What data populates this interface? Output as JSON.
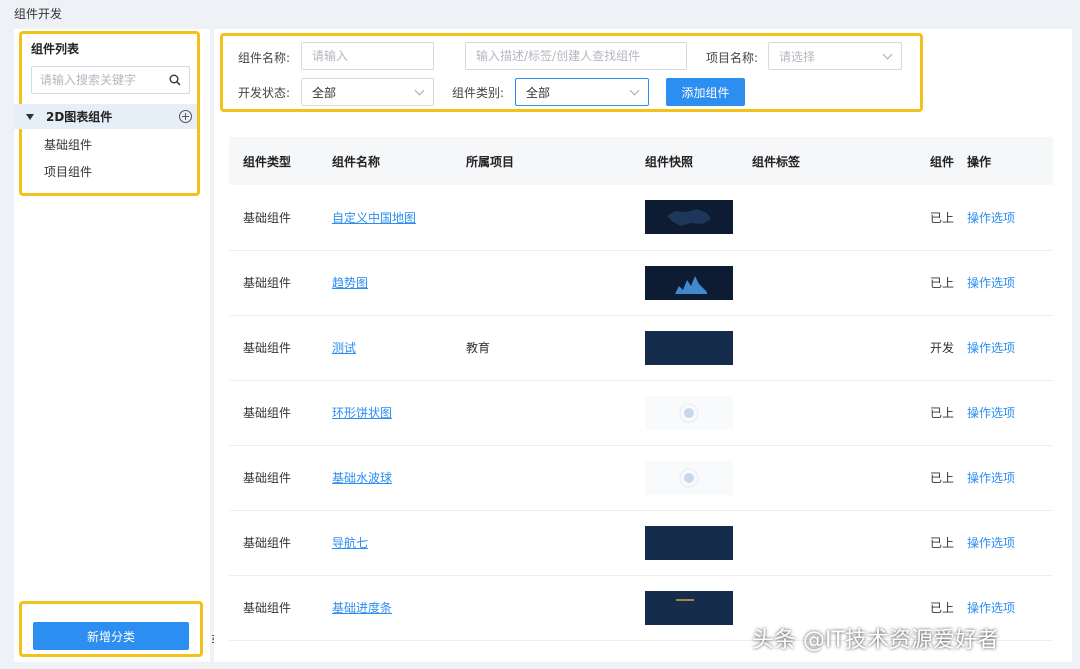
{
  "page": {
    "title": "组件开发"
  },
  "sidebar": {
    "title": "组件列表",
    "search_placeholder": "请输入搜索关键字",
    "group": {
      "label": "2D图表组件"
    },
    "items": [
      {
        "label": "基础组件"
      },
      {
        "label": "项目组件"
      }
    ],
    "add_category_label": "新增分类"
  },
  "filters": {
    "name_label": "组件名称:",
    "name_placeholder": "请输入",
    "desc_placeholder": "输入描述/标签/创建人查找组件",
    "project_label": "项目名称:",
    "project_placeholder": "请选择",
    "status_label": "开发状态:",
    "status_value": "全部",
    "type_label": "组件类别:",
    "type_value": "全部",
    "add_button": "添加组件"
  },
  "table": {
    "headers": {
      "type": "组件类型",
      "name": "组件名称",
      "project": "所属项目",
      "snapshot": "组件快照",
      "tags": "组件标签",
      "status": "组件",
      "actions": "操作"
    },
    "rows": [
      {
        "type": "基础组件",
        "name": "自定义中国地图",
        "project": "",
        "thumb": "dark",
        "status": "已上",
        "action": "操作选项"
      },
      {
        "type": "基础组件",
        "name": "趋势图",
        "project": "",
        "thumb": "trend",
        "status": "已上",
        "action": "操作选项"
      },
      {
        "type": "基础组件",
        "name": "测试",
        "project": "教育",
        "thumb": "navy",
        "status": "开发",
        "action": "操作选项"
      },
      {
        "type": "基础组件",
        "name": "环形饼状图",
        "project": "",
        "thumb": "light",
        "status": "已上",
        "action": "操作选项"
      },
      {
        "type": "基础组件",
        "name": "基础水波球",
        "project": "",
        "thumb": "light",
        "status": "已上",
        "action": "操作选项"
      },
      {
        "type": "基础组件",
        "name": "导航七",
        "project": "",
        "thumb": "navy",
        "status": "已上",
        "action": "操作选项"
      },
      {
        "type": "基础组件",
        "name": "基础进度条",
        "project": "",
        "thumb": "progress",
        "status": "已上",
        "action": "操作选项"
      }
    ]
  },
  "watermark": "头条 @IT技术资源爱好者",
  "colors": {
    "accent": "#2b8ef0",
    "highlight": "#f2c21a"
  }
}
